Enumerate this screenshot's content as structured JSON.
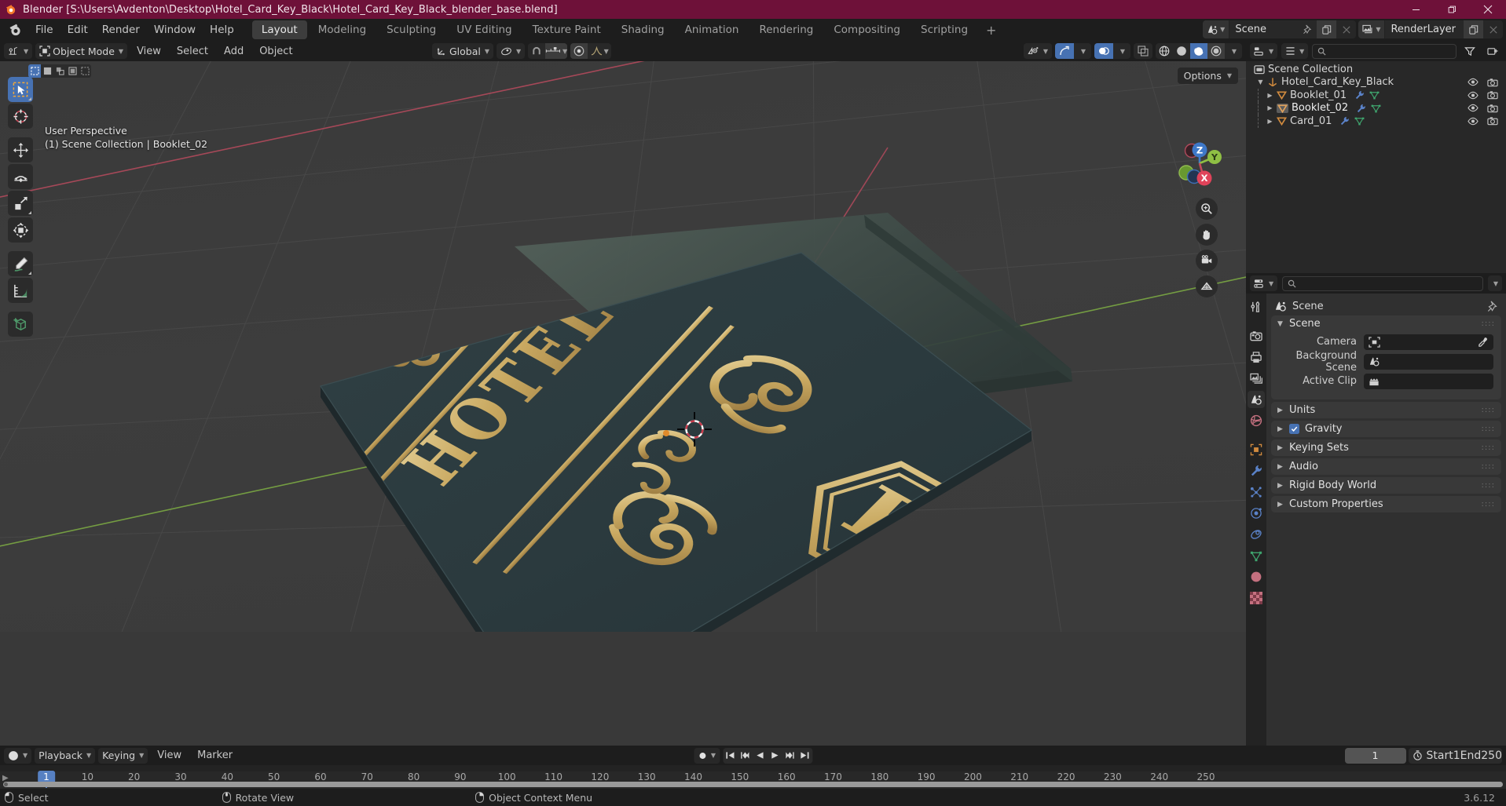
{
  "titlebar": {
    "title": "Blender [S:\\Users\\Avdenton\\Desktop\\Hotel_Card_Key_Black\\Hotel_Card_Key_Black_blender_base.blend]",
    "minimize": "minimize-icon",
    "maximize": "restore-icon",
    "close": "close-icon"
  },
  "topbar": {
    "menus": [
      "File",
      "Edit",
      "Render",
      "Window",
      "Help"
    ],
    "workspaces": [
      {
        "label": "Layout",
        "active": true
      },
      {
        "label": "Modeling",
        "active": false
      },
      {
        "label": "Sculpting",
        "active": false
      },
      {
        "label": "UV Editing",
        "active": false
      },
      {
        "label": "Texture Paint",
        "active": false
      },
      {
        "label": "Shading",
        "active": false
      },
      {
        "label": "Animation",
        "active": false
      },
      {
        "label": "Rendering",
        "active": false
      },
      {
        "label": "Compositing",
        "active": false
      },
      {
        "label": "Scripting",
        "active": false
      }
    ],
    "add_workspace": "+",
    "scene_name": "Scene",
    "viewlayer_name": "RenderLayer"
  },
  "viewport": {
    "mode": "Object Mode",
    "menus": [
      "View",
      "Select",
      "Add",
      "Object"
    ],
    "transform_orientation": "Global",
    "overlay_line1": "User Perspective",
    "overlay_line2": "(1) Scene Collection | Booklet_02",
    "options_label": "Options",
    "gizmo_axes": [
      "Z",
      "Y",
      "X"
    ],
    "nav_buttons": [
      "zoom-icon",
      "pan-hand-icon",
      "camera-icon",
      "grid-ortho-icon"
    ],
    "tools": [
      {
        "name": "tweak-select-tool",
        "selected": true
      },
      {
        "name": "cursor-tool",
        "selected": false
      },
      {
        "name": "move-tool",
        "selected": false
      },
      {
        "name": "rotate-tool",
        "selected": false
      },
      {
        "name": "scale-tool",
        "selected": false
      },
      {
        "name": "transform-tool",
        "selected": false
      },
      {
        "name": "annotate-tool",
        "selected": false
      },
      {
        "name": "measure-tool",
        "selected": false
      },
      {
        "name": "add-cube-tool",
        "selected": false
      }
    ]
  },
  "outliner": {
    "rows": [
      {
        "label": "Scene Collection",
        "depth": 0,
        "icon": "collection-icon",
        "disclosure": "",
        "selected": false,
        "has_modifier": false
      },
      {
        "label": "Hotel_Card_Key_Black",
        "depth": 1,
        "icon": "empty-axis-icon",
        "disclosure": "down",
        "selected": false,
        "has_modifier": false
      },
      {
        "label": "Booklet_01",
        "depth": 2,
        "icon": "mesh-tri-icon",
        "disclosure": "right",
        "selected": false,
        "has_modifier": true
      },
      {
        "label": "Booklet_02",
        "depth": 2,
        "icon": "mesh-tri-icon",
        "disclosure": "right",
        "selected": true,
        "has_modifier": true
      },
      {
        "label": "Card_01",
        "depth": 2,
        "icon": "mesh-tri-icon",
        "disclosure": "right",
        "selected": false,
        "has_modifier": true
      }
    ]
  },
  "properties": {
    "breadcrumb": "Scene",
    "tabs": [
      {
        "name": "tool-tab",
        "active": false
      },
      {
        "name": "render-tab",
        "active": false
      },
      {
        "name": "output-tab",
        "active": false
      },
      {
        "name": "view-layer-tab",
        "active": false
      },
      {
        "name": "scene-tab",
        "active": true
      },
      {
        "name": "world-tab",
        "active": false
      },
      {
        "name": "object-tab",
        "active": false
      },
      {
        "name": "modifier-tab",
        "active": false
      },
      {
        "name": "particles-tab",
        "active": false
      },
      {
        "name": "physics-tab",
        "active": false
      },
      {
        "name": "constraints-tab",
        "active": false
      },
      {
        "name": "object-data-tab",
        "active": false
      },
      {
        "name": "material-tab",
        "active": false
      },
      {
        "name": "texture-tab",
        "active": false
      }
    ],
    "scene_panel": {
      "title": "Scene",
      "rows": [
        {
          "label": "Camera",
          "value": "",
          "icon": "camera-field-icon",
          "eyedropper": true
        },
        {
          "label": "Background Scene",
          "value": "",
          "icon": "scene-field-icon",
          "eyedropper": false
        },
        {
          "label": "Active Clip",
          "value": "",
          "icon": "clip-field-icon",
          "eyedropper": false
        }
      ]
    },
    "collapsed_panels": [
      {
        "label": "Units",
        "checkbox": null
      },
      {
        "label": "Gravity",
        "checkbox": true
      },
      {
        "label": "Keying Sets",
        "checkbox": null
      },
      {
        "label": "Audio",
        "checkbox": null
      },
      {
        "label": "Rigid Body World",
        "checkbox": null
      },
      {
        "label": "Custom Properties",
        "checkbox": null
      }
    ]
  },
  "timeline": {
    "menus": [
      "Playback",
      "Keying",
      "View",
      "Marker"
    ],
    "current_frame": "1",
    "start_label": "Start",
    "start_value": "1",
    "end_label": "End",
    "end_value": "250",
    "ticks": [
      1,
      10,
      20,
      30,
      40,
      50,
      60,
      70,
      80,
      90,
      100,
      110,
      120,
      130,
      140,
      150,
      160,
      170,
      180,
      190,
      200,
      210,
      220,
      230,
      240,
      250
    ],
    "playhead_frame": "1",
    "transport": [
      "jump-start-icon",
      "prev-keyframe-icon",
      "play-reverse-icon",
      "play-icon",
      "next-keyframe-icon",
      "jump-end-icon"
    ]
  },
  "statusbar": {
    "items": [
      {
        "mouse": "left-mouse-icon",
        "label": "Select"
      },
      {
        "mouse": "middle-mouse-icon",
        "label": "Rotate View"
      },
      {
        "mouse": "right-mouse-icon",
        "label": "Object Context Menu"
      }
    ],
    "version": "3.6.12"
  },
  "colors": {
    "title_bar": "#6e1139",
    "accent_blue": "#4772b3",
    "card_body": "#2c3a3d",
    "gold": "#c9a961",
    "header_bg": "#1d1d1d",
    "panel_bg": "#303030"
  }
}
